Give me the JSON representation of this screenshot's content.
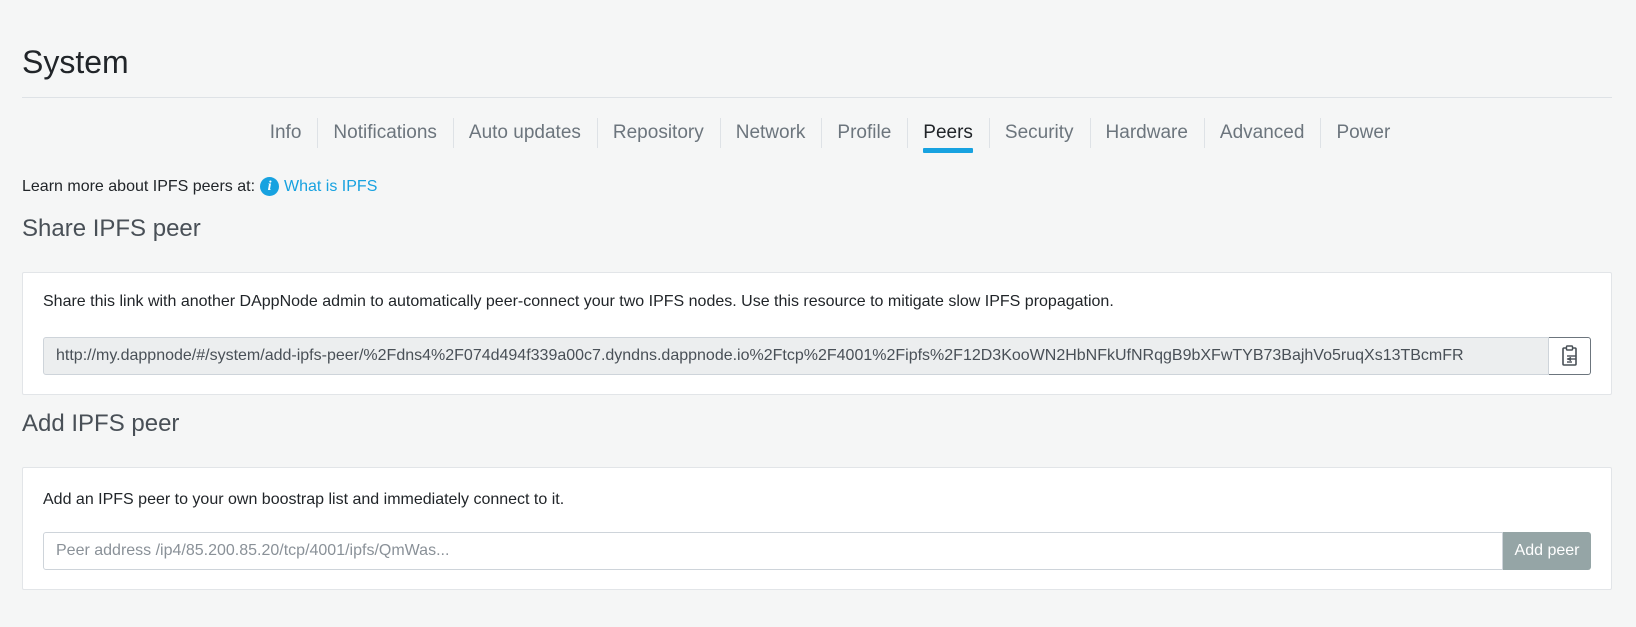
{
  "page": {
    "title": "System"
  },
  "tabs": [
    {
      "label": "Info"
    },
    {
      "label": "Notifications"
    },
    {
      "label": "Auto updates"
    },
    {
      "label": "Repository"
    },
    {
      "label": "Network"
    },
    {
      "label": "Profile"
    },
    {
      "label": "Peers",
      "active": true
    },
    {
      "label": "Security"
    },
    {
      "label": "Hardware"
    },
    {
      "label": "Advanced"
    },
    {
      "label": "Power"
    }
  ],
  "learn_more": {
    "prefix": "Learn more about IPFS peers at:",
    "icon": "info-icon",
    "link_text": "What is IPFS"
  },
  "share": {
    "title": "Share IPFS peer",
    "description": "Share this link with another DAppNode admin to automatically peer-connect your two IPFS nodes. Use this resource to mitigate slow IPFS propagation.",
    "link_value": "http://my.dappnode/#/system/add-ipfs-peer/%2Fdns4%2F074d494f339a00c7.dyndns.dappnode.io%2Ftcp%2F4001%2Fipfs%2F12D3KooWN2HbNFkUfNRqgB9bXFwTYB73BajhVo5ruqXs13TBcmFR",
    "copy_icon": "clipboard-icon"
  },
  "add": {
    "title": "Add IPFS peer",
    "description": "Add an IPFS peer to your own boostrap list and immediately connect to it.",
    "placeholder": "Peer address /ip4/85.200.85.20/tcp/4001/ipfs/QmWas...",
    "button_label": "Add peer"
  },
  "colors": {
    "accent": "#17a2e0",
    "button_disabled": "#95a5a6"
  }
}
